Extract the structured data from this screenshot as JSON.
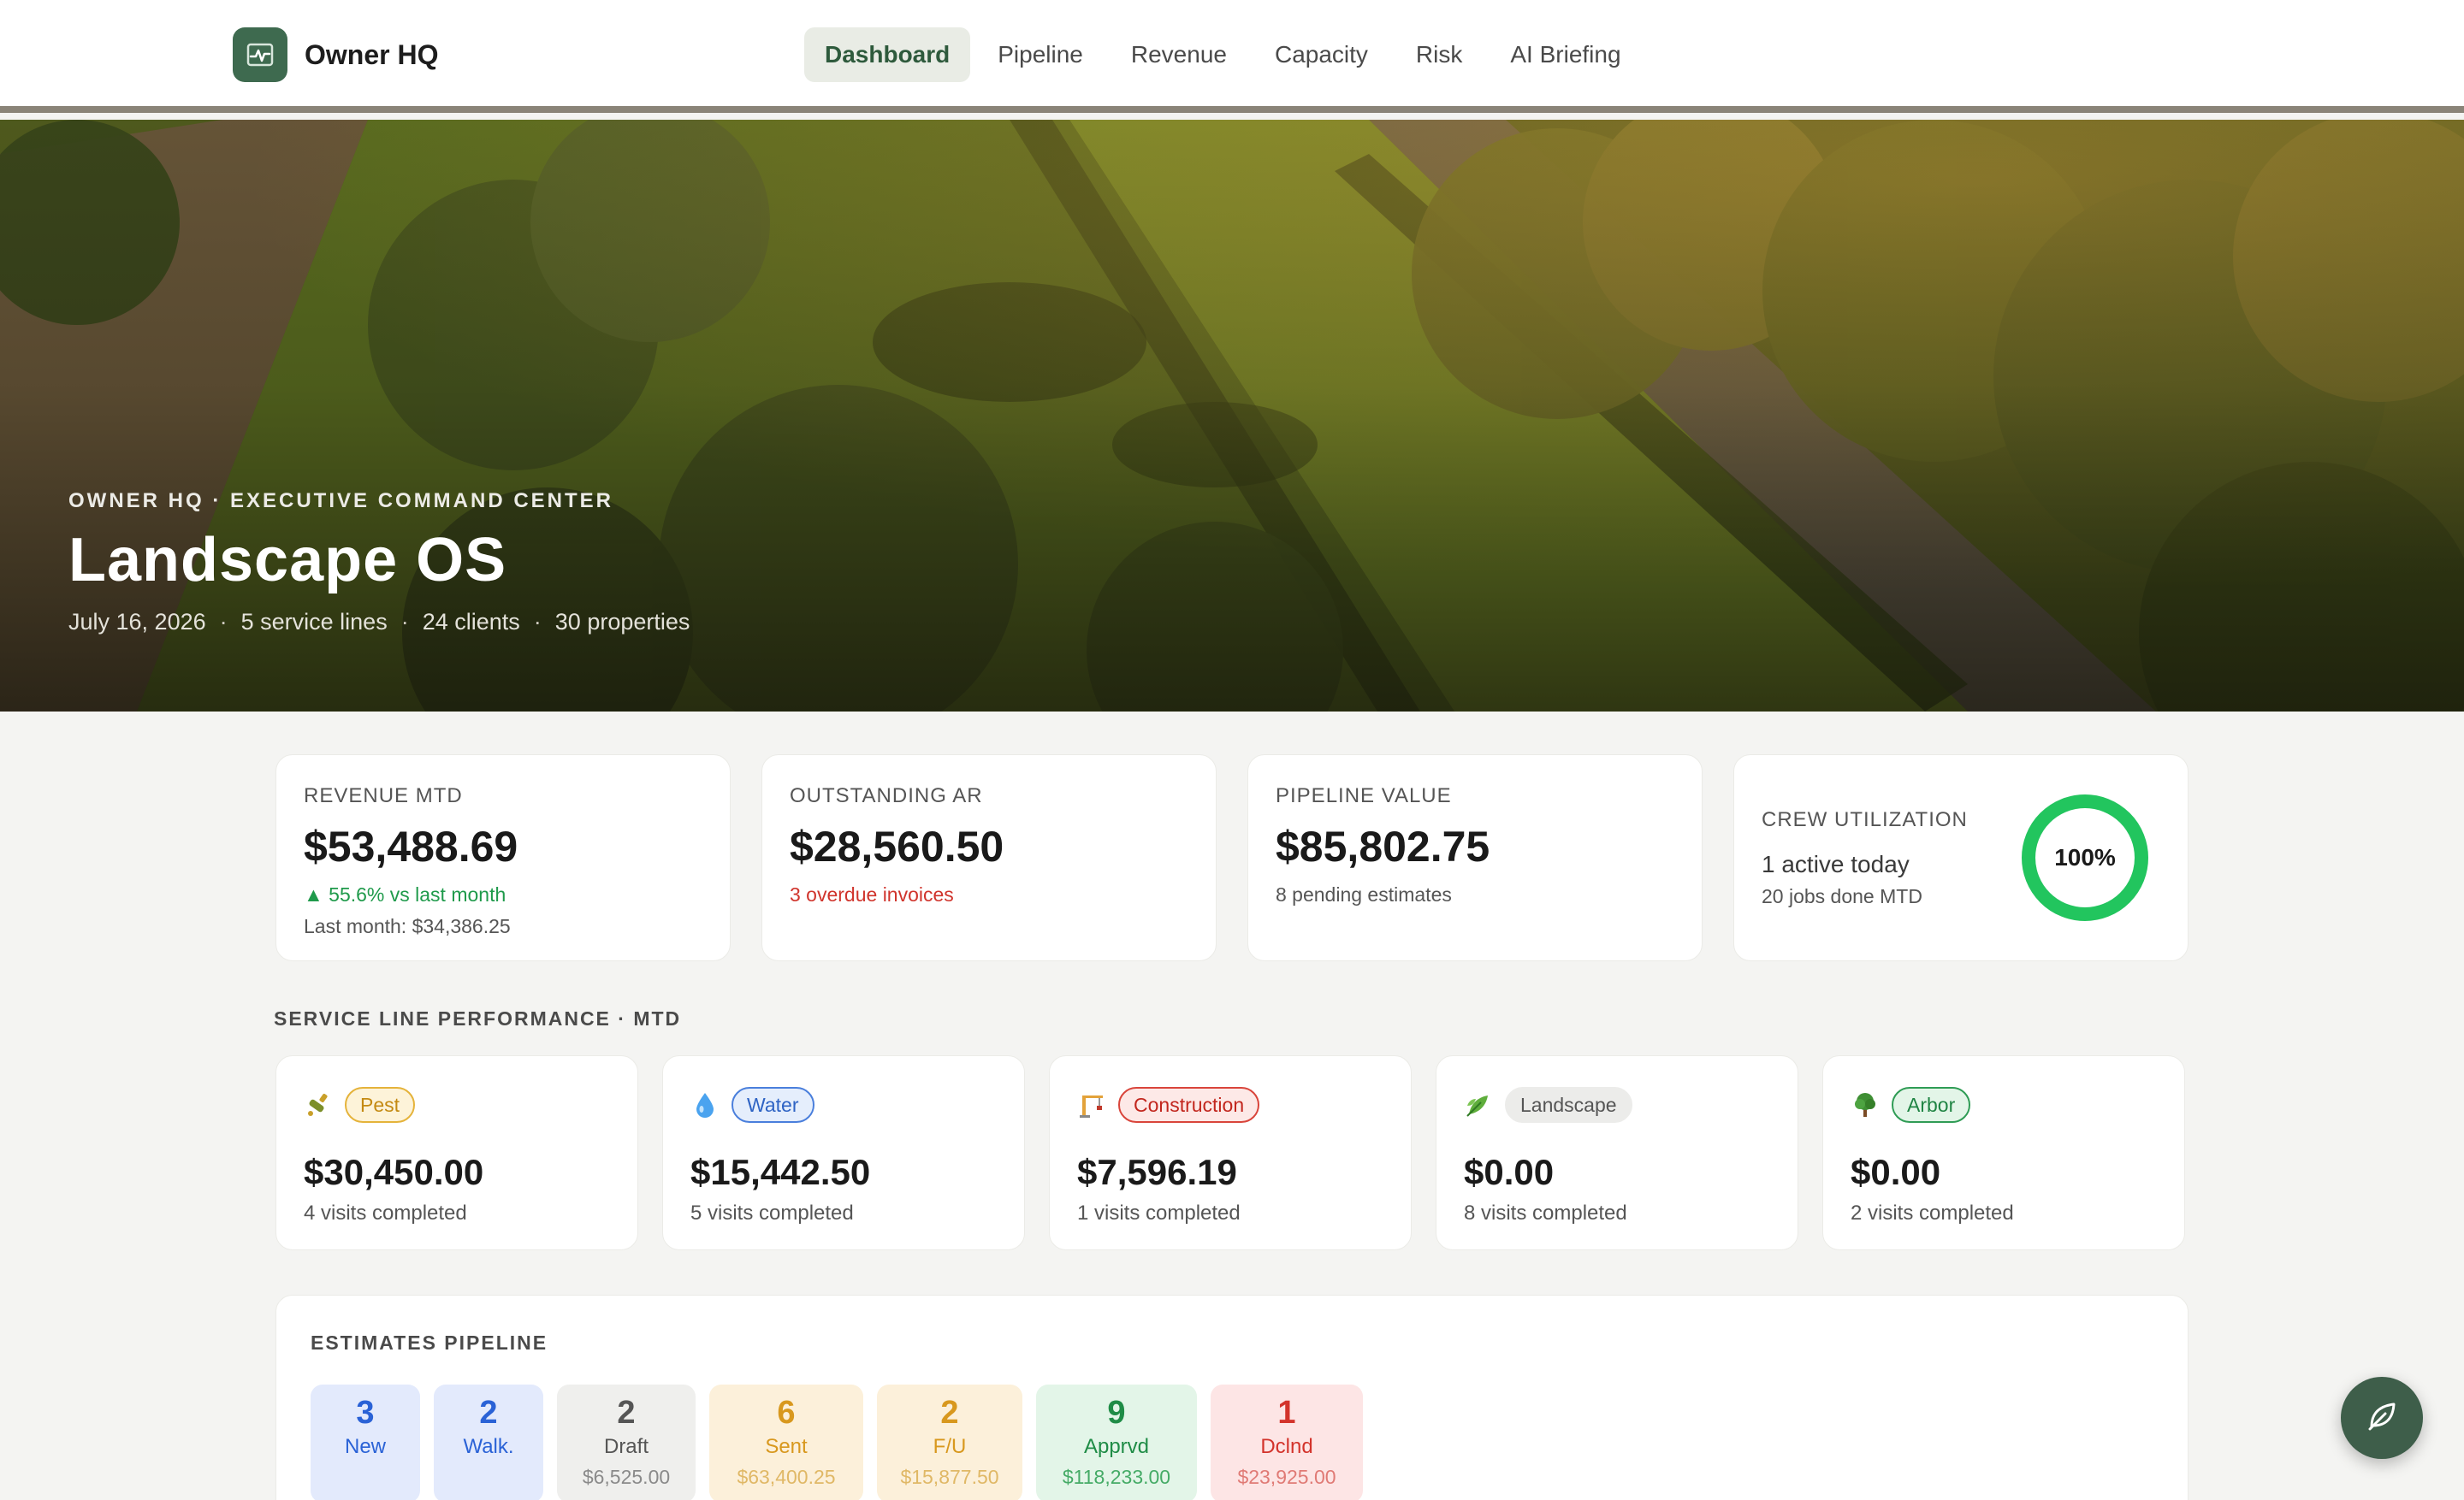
{
  "app": {
    "name": "Owner HQ"
  },
  "nav": {
    "items": [
      {
        "label": "Dashboard",
        "active": true
      },
      {
        "label": "Pipeline"
      },
      {
        "label": "Revenue"
      },
      {
        "label": "Capacity"
      },
      {
        "label": "Risk"
      },
      {
        "label": "AI Briefing"
      }
    ]
  },
  "hero": {
    "eyebrow": "OWNER HQ · EXECUTIVE COMMAND CENTER",
    "title": "Landscape OS",
    "date": "July 16, 2026",
    "service_lines": "5 service lines",
    "clients": "24 clients",
    "properties": "30 properties",
    "separator": "·"
  },
  "kpis": {
    "revenue": {
      "label": "REVENUE MTD",
      "value": "$53,488.69",
      "change": "▲ 55.6% vs last month",
      "last_month": "Last month: $34,386.25"
    },
    "ar": {
      "label": "OUTSTANDING AR",
      "value": "$28,560.50",
      "note": "3 overdue invoices"
    },
    "pipeline": {
      "label": "PIPELINE VALUE",
      "value": "$85,802.75",
      "note": "8 pending estimates"
    },
    "crew": {
      "label": "CREW UTILIZATION",
      "active": "1 active today",
      "done": "20 jobs done MTD",
      "percent_label": "100%",
      "percent": 100,
      "ring_color": "#22c55e"
    }
  },
  "service_section": {
    "title": "SERVICE LINE PERFORMANCE · MTD"
  },
  "service_lines": [
    {
      "name": "Pest",
      "icon": "bug-spray-icon",
      "value": "$30,450.00",
      "visits": "4 visits completed"
    },
    {
      "name": "Water",
      "icon": "water-drop-icon",
      "value": "$15,442.50",
      "visits": "5 visits completed"
    },
    {
      "name": "Construction",
      "icon": "crane-icon",
      "value": "$7,596.19",
      "visits": "1 visits completed"
    },
    {
      "name": "Landscape",
      "icon": "leaves-icon",
      "value": "$0.00",
      "visits": "8 visits completed"
    },
    {
      "name": "Arbor",
      "icon": "tree-icon",
      "value": "$0.00",
      "visits": "2 visits completed"
    }
  ],
  "pipeline": {
    "title": "ESTIMATES PIPELINE",
    "stages": [
      {
        "count": "3",
        "label": "New",
        "amount": ""
      },
      {
        "count": "2",
        "label": "Walk.",
        "amount": ""
      },
      {
        "count": "2",
        "label": "Draft",
        "amount": "$6,525.00"
      },
      {
        "count": "6",
        "label": "Sent",
        "amount": "$63,400.25"
      },
      {
        "count": "2",
        "label": "F/U",
        "amount": "$15,877.50"
      },
      {
        "count": "9",
        "label": "Apprvd",
        "amount": "$118,233.00"
      },
      {
        "count": "1",
        "label": "Dclnd",
        "amount": "$23,925.00"
      }
    ]
  },
  "colors": {
    "brand": "#3e6a4f",
    "accent_green": "#1f9a4b",
    "alert_red": "#d0342c"
  }
}
